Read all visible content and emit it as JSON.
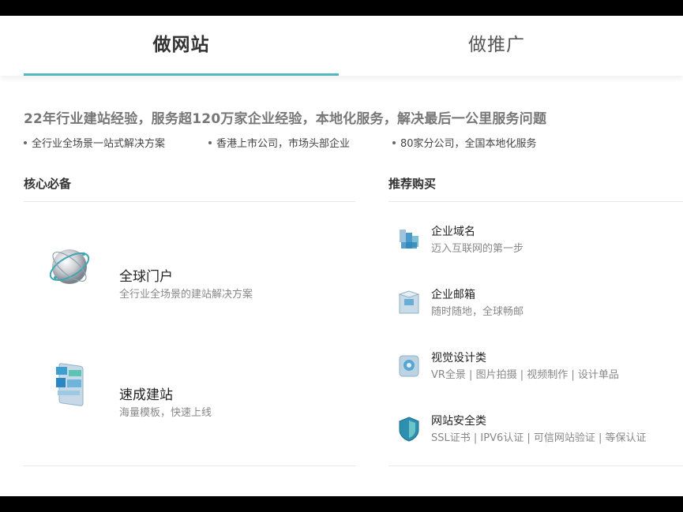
{
  "tabs": [
    {
      "label": "做网站",
      "active": true
    },
    {
      "label": "做推广",
      "active": false
    }
  ],
  "headline": "22年行业建站经验，服务超120万家企业经验，本地化服务，解决最后一公里服务问题",
  "bullets": [
    "全行业全场景一站式解决方案",
    "香港上市公司，市场头部企业",
    "80家分公司，全国本地化服务"
  ],
  "core": {
    "title": "核心必备",
    "items": [
      {
        "title": "全球门户",
        "desc": "全行业全场景的建站解决方案",
        "icon": "globe-icon"
      },
      {
        "title": "速成建站",
        "desc": "海量模板，快速上线",
        "icon": "template-blocks-icon"
      }
    ]
  },
  "recommend": {
    "title": "推荐购买",
    "items": [
      {
        "title": "企业域名",
        "desc": "迈入互联网的第一步",
        "icon": "domain-icon"
      },
      {
        "title": "企业邮箱",
        "desc": "随时随地，全球畅邮",
        "icon": "mailbox-icon"
      },
      {
        "title": "视觉设计类",
        "desc": "VR全景 | 图片拍摄 | 视频制作 | 设计单品",
        "icon": "camera-icon"
      },
      {
        "title": "网站安全类",
        "desc": "SSL证书 | IPV6认证 | 可信网站验证 | 等保认证",
        "icon": "shield-icon"
      }
    ]
  },
  "colors": {
    "accent": "#52b6bd"
  }
}
